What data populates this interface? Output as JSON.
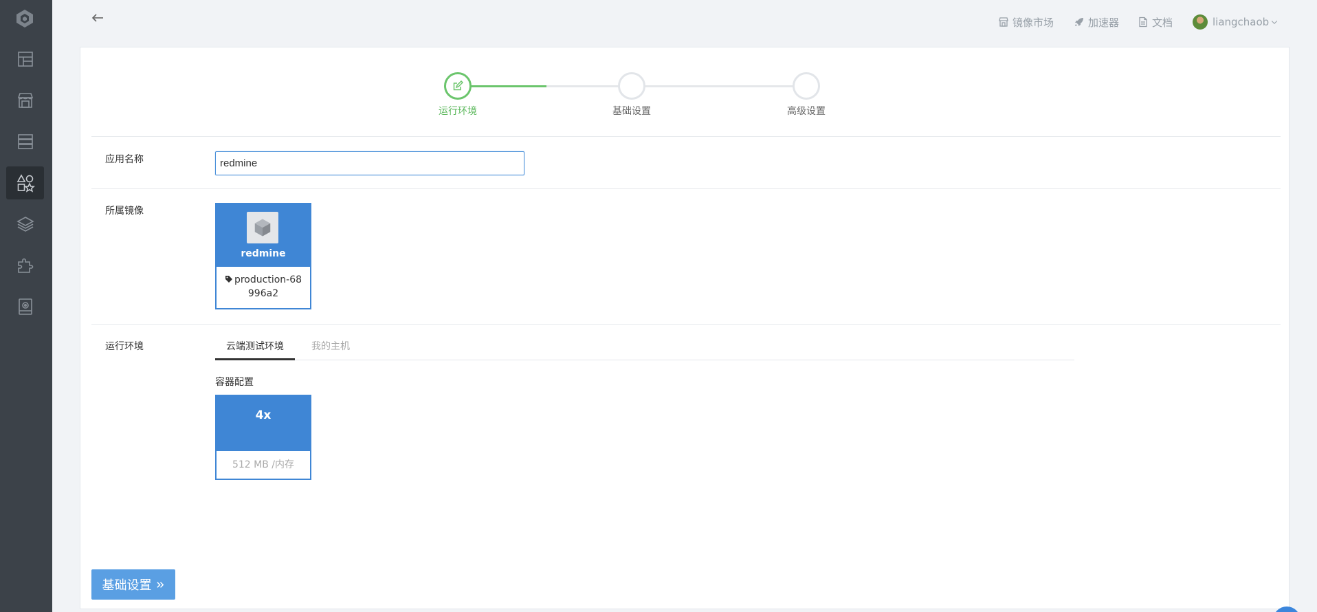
{
  "sidebar": {
    "items": [
      {
        "icon": "dashboard-icon",
        "active": false
      },
      {
        "icon": "store-icon",
        "active": false
      },
      {
        "icon": "server-icon",
        "active": false
      },
      {
        "icon": "apps-icon",
        "active": true
      },
      {
        "icon": "layers-icon",
        "active": false
      },
      {
        "icon": "plugin-icon",
        "active": false
      },
      {
        "icon": "monitor-icon",
        "active": false
      }
    ]
  },
  "header": {
    "nav": [
      {
        "label": "镜像市场",
        "icon": "store-icon"
      },
      {
        "label": "加速器",
        "icon": "rocket-icon"
      },
      {
        "label": "文档",
        "icon": "document-icon"
      }
    ],
    "user": "liangchaob"
  },
  "steps": [
    {
      "label": "运行环境",
      "state": "active"
    },
    {
      "label": "基础设置",
      "state": "pending"
    },
    {
      "label": "高级设置",
      "state": "pending"
    }
  ],
  "form": {
    "app_name_label": "应用名称",
    "app_name_value": "redmine",
    "image_label": "所属镜像",
    "image": {
      "name": "redmine",
      "tag": "production-68996a2"
    },
    "env_label": "运行环境",
    "env_tabs": [
      {
        "label": "云端测试环境",
        "active": true
      },
      {
        "label": "我的主机",
        "active": false
      }
    ],
    "container_label": "容器配置",
    "container": {
      "size": "4x",
      "memory": "512 MB",
      "memory_unit": "/内存"
    }
  },
  "actions": {
    "next_label": "基础设置"
  },
  "colors": {
    "accent": "#3f86d5",
    "success": "#6bc56c",
    "sidebar": "#3c4249"
  }
}
